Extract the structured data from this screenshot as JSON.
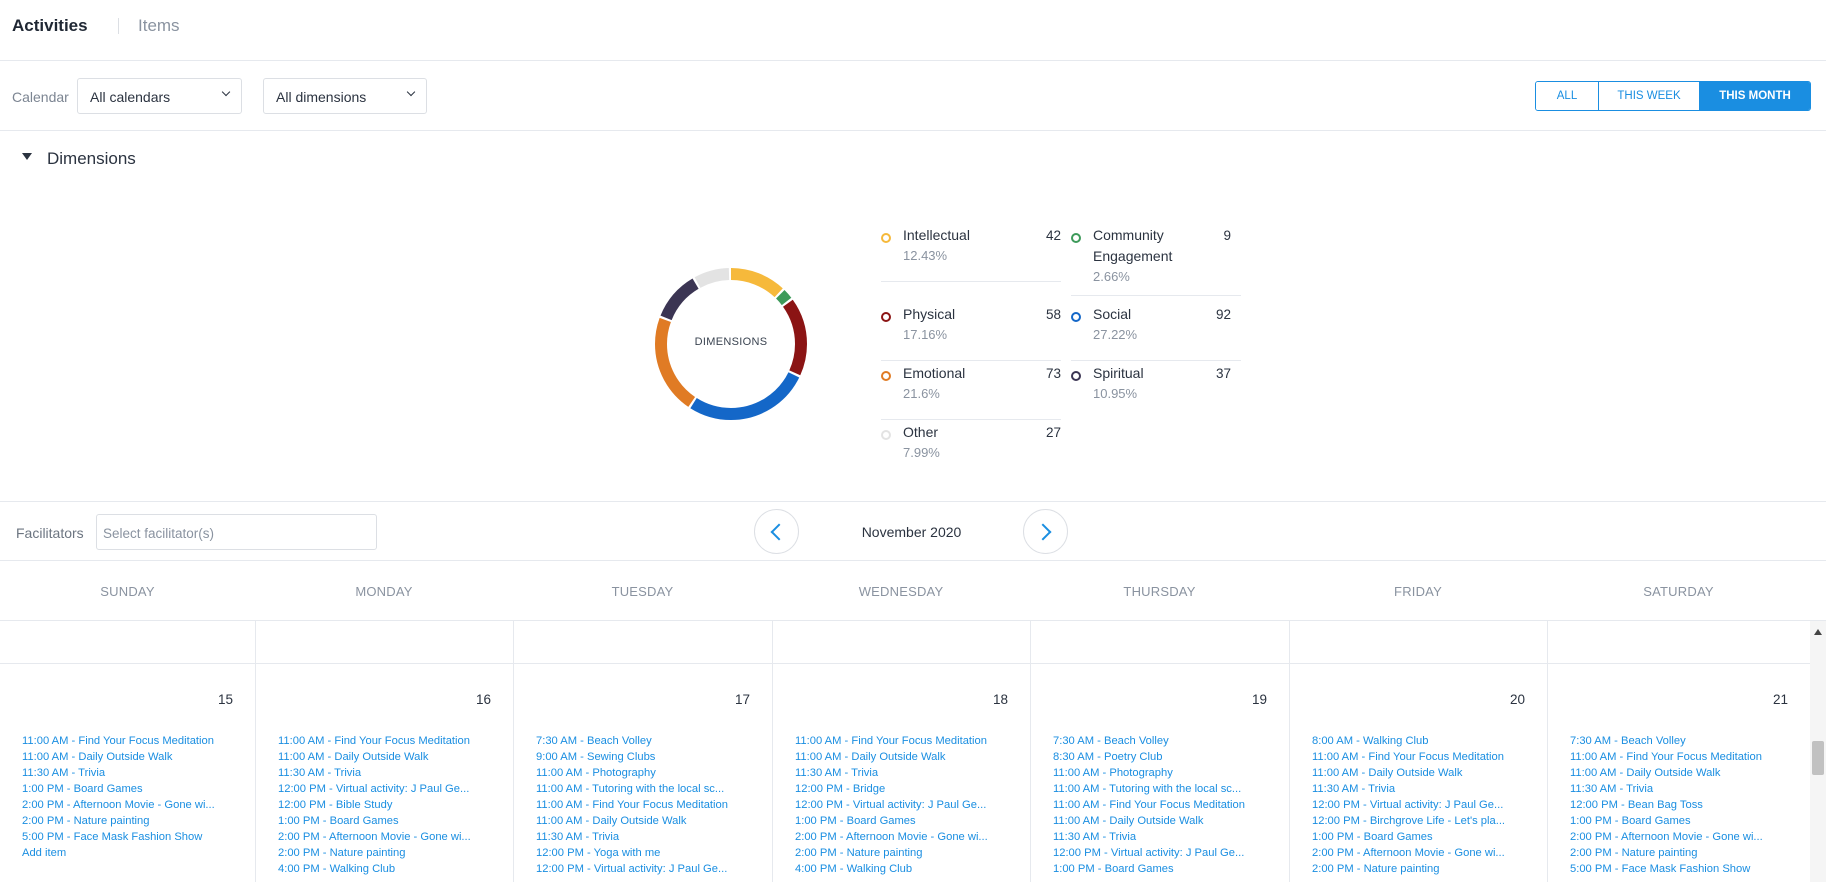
{
  "tabs": {
    "activities": "Activities",
    "items": "Items"
  },
  "filters": {
    "calendar_label": "Calendar",
    "calendar_value": "All calendars",
    "dimensions_value": "All dimensions",
    "range": {
      "all": "ALL",
      "this_week": "THIS WEEK",
      "this_month": "THIS MONTH",
      "selected": "THIS MONTH"
    }
  },
  "dimensions": {
    "title": "Dimensions",
    "center_label": "DIMENSIONS",
    "items": [
      {
        "name": "Intellectual",
        "pct": "12.43%",
        "count": "42",
        "color": "#f6b93b"
      },
      {
        "name": "Community",
        "name2": "Engagement",
        "pct": "2.66%",
        "count": "9",
        "color": "#3d9a5a"
      },
      {
        "name": "Physical",
        "pct": "17.16%",
        "count": "58",
        "color": "#8b1414"
      },
      {
        "name": "Social",
        "pct": "27.22%",
        "count": "92",
        "color": "#1467c8"
      },
      {
        "name": "Emotional",
        "pct": "21.6%",
        "count": "73",
        "color": "#e07b24"
      },
      {
        "name": "Spiritual",
        "pct": "10.95%",
        "count": "37",
        "color": "#3b3553"
      },
      {
        "name": "Other",
        "pct": "7.99%",
        "count": "27",
        "color": "#e3e3e3"
      }
    ]
  },
  "facilitators": {
    "label": "Facilitators",
    "placeholder": "Select facilitator(s)"
  },
  "calendar": {
    "month": "November 2020",
    "day_headers": [
      "SUNDAY",
      "MONDAY",
      "TUESDAY",
      "WEDNESDAY",
      "THURSDAY",
      "FRIDAY",
      "SATURDAY"
    ],
    "week": [
      {
        "day": "15",
        "events": [
          "11:00 AM - Find Your Focus Meditation",
          "11:00 AM - Daily Outside Walk",
          "11:30 AM - Trivia",
          "1:00 PM - Board Games",
          "2:00 PM - Afternoon Movie - Gone wi...",
          "2:00 PM - Nature painting",
          "5:00 PM - Face Mask Fashion Show",
          "Add item"
        ]
      },
      {
        "day": "16",
        "events": [
          "11:00 AM - Find Your Focus Meditation",
          "11:00 AM - Daily Outside Walk",
          "11:30 AM - Trivia",
          "12:00 PM - Virtual activity: J Paul Ge...",
          "12:00 PM - Bible Study",
          "1:00 PM - Board Games",
          "2:00 PM - Afternoon Movie - Gone wi...",
          "2:00 PM - Nature painting",
          "4:00 PM - Walking Club"
        ]
      },
      {
        "day": "17",
        "events": [
          "7:30 AM - Beach Volley",
          "9:00 AM - Sewing Clubs",
          "11:00 AM - Photography",
          "11:00 AM - Tutoring with the local sc...",
          "11:00 AM - Find Your Focus Meditation",
          "11:00 AM - Daily Outside Walk",
          "11:30 AM - Trivia",
          "12:00 PM - Yoga with me",
          "12:00 PM - Virtual activity: J Paul Ge..."
        ]
      },
      {
        "day": "18",
        "events": [
          "11:00 AM - Find Your Focus Meditation",
          "11:00 AM - Daily Outside Walk",
          "11:30 AM - Trivia",
          "12:00 PM - Bridge",
          "12:00 PM - Virtual activity: J Paul Ge...",
          "1:00 PM - Board Games",
          "2:00 PM - Afternoon Movie - Gone wi...",
          "2:00 PM - Nature painting",
          "4:00 PM - Walking Club"
        ]
      },
      {
        "day": "19",
        "events": [
          "7:30 AM - Beach Volley",
          "8:30 AM - Poetry Club",
          "11:00 AM - Photography",
          "11:00 AM - Tutoring with the local sc...",
          "11:00 AM - Find Your Focus Meditation",
          "11:00 AM - Daily Outside Walk",
          "11:30 AM - Trivia",
          "12:00 PM - Virtual activity: J Paul Ge...",
          "1:00 PM - Board Games"
        ]
      },
      {
        "day": "20",
        "events": [
          "8:00 AM - Walking Club",
          "11:00 AM - Find Your Focus Meditation",
          "11:00 AM - Daily Outside Walk",
          "11:30 AM - Trivia",
          "12:00 PM - Virtual activity: J Paul Ge...",
          "12:00 PM - Birchgrove Life - Let's pla...",
          "1:00 PM - Board Games",
          "2:00 PM - Afternoon Movie - Gone wi...",
          "2:00 PM - Nature painting"
        ]
      },
      {
        "day": "21",
        "events": [
          "7:30 AM - Beach Volley",
          "11:00 AM - Find Your Focus Meditation",
          "11:00 AM - Daily Outside Walk",
          "11:30 AM - Trivia",
          "12:00 PM - Bean Bag Toss",
          "1:00 PM - Board Games",
          "2:00 PM - Afternoon Movie - Gone wi...",
          "2:00 PM - Nature painting",
          "5:00 PM - Face Mask Fashion Show"
        ]
      }
    ]
  }
}
